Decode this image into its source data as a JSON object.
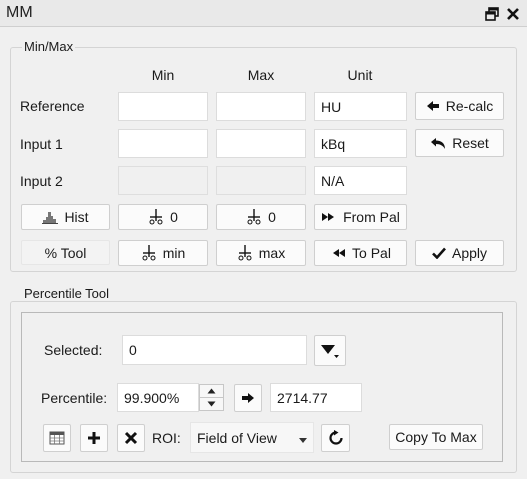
{
  "window": {
    "title": "MM"
  },
  "minmax": {
    "group_title": "Min/Max",
    "headers": {
      "min": "Min",
      "max": "Max",
      "unit": "Unit"
    },
    "rows": [
      {
        "label": "Reference",
        "min": "",
        "max": "",
        "unit": "HU"
      },
      {
        "label": "Input 1",
        "min": "",
        "max": "",
        "unit": "kBq"
      },
      {
        "label": "Input 2",
        "min": "",
        "max": "",
        "unit": "N/A"
      }
    ],
    "buttons": {
      "recalc": "Re-calc",
      "reset": "Reset",
      "hist": "Hist",
      "zero_min": "0",
      "zero_max": "0",
      "from_pal": "From Pal",
      "pct_tool": "% Tool",
      "set_min": "min",
      "set_max": "max",
      "to_pal": "To Pal",
      "apply": "Apply"
    }
  },
  "percentile": {
    "group_title": "Percentile Tool",
    "selected_label": "Selected:",
    "selected_value": "0",
    "percentile_label": "Percentile:",
    "percentile_value": "99.900%",
    "result_value": "2714.77",
    "roi_label": "ROI:",
    "roi_value": "Field of View",
    "copy_to_max": "Copy To Max"
  },
  "colors": {
    "background": "#f0f0f0",
    "field": "#ffffff",
    "border": "#d4d4d4"
  }
}
